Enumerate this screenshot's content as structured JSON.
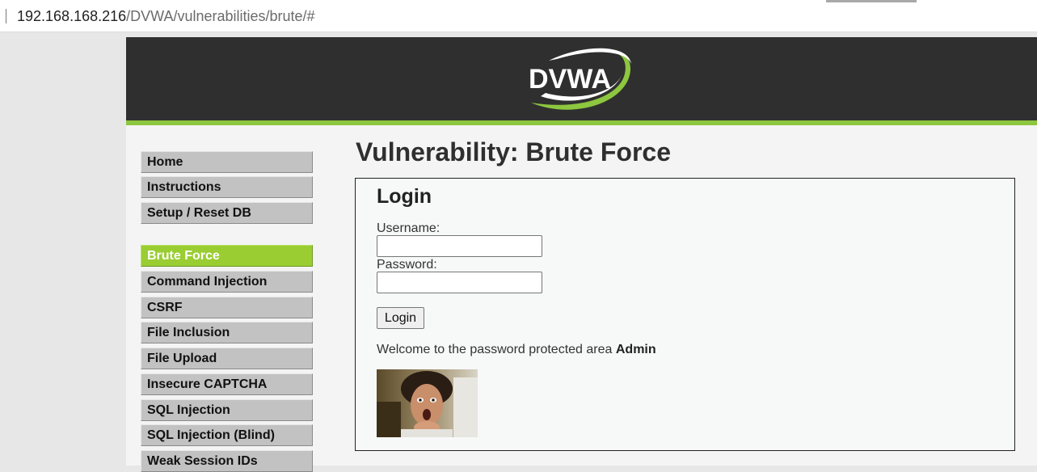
{
  "browser": {
    "url_host": "192.168.168.216",
    "url_path": "/DVWA/vulnerabilities/brute/#"
  },
  "header": {
    "logo_text": "DVWA"
  },
  "menu": {
    "items": [
      {
        "label": "Home"
      },
      {
        "label": "Instructions"
      },
      {
        "label": "Setup / Reset DB"
      },
      {
        "label": "Brute Force",
        "active": true
      },
      {
        "label": "Command Injection"
      },
      {
        "label": "CSRF"
      },
      {
        "label": "File Inclusion"
      },
      {
        "label": "File Upload"
      },
      {
        "label": "Insecure CAPTCHA"
      },
      {
        "label": "SQL Injection"
      },
      {
        "label": "SQL Injection (Blind)"
      },
      {
        "label": "Weak Session IDs"
      }
    ]
  },
  "main": {
    "title": "Vulnerability: Brute Force",
    "login": {
      "heading": "Login",
      "username_label": "Username:",
      "username_value": "",
      "password_label": "Password:",
      "password_value": "",
      "submit_label": "Login"
    },
    "welcome_text": "Welcome to the password protected area ",
    "welcome_user": "Admin"
  },
  "colors": {
    "header_bg": "#2f2f2f",
    "accent_green": "#9acd32",
    "menu_bg": "#c2c2c2"
  }
}
